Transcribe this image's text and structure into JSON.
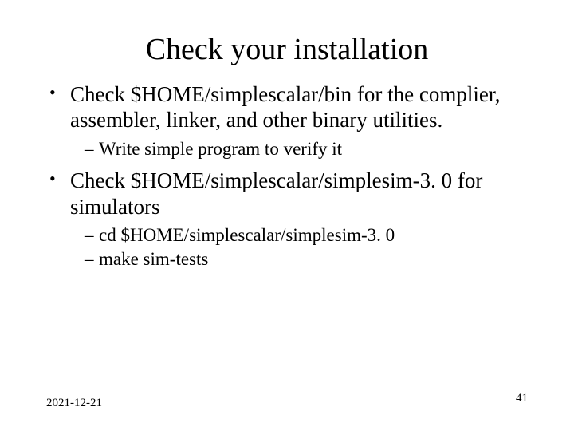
{
  "title": "Check your installation",
  "bullets": {
    "b1": "Check $HOME/simplescalar/bin for the complier, assembler, linker, and other binary utilities.",
    "b1_sub1": "Write simple program to verify it",
    "b2": "Check $HOME/simplescalar/simplesim-3. 0 for simulators",
    "b2_sub1": "cd $HOME/simplescalar/simplesim-3. 0",
    "b2_sub2": "make sim-tests"
  },
  "footer": {
    "date": "2021-12-21",
    "page": "41"
  }
}
